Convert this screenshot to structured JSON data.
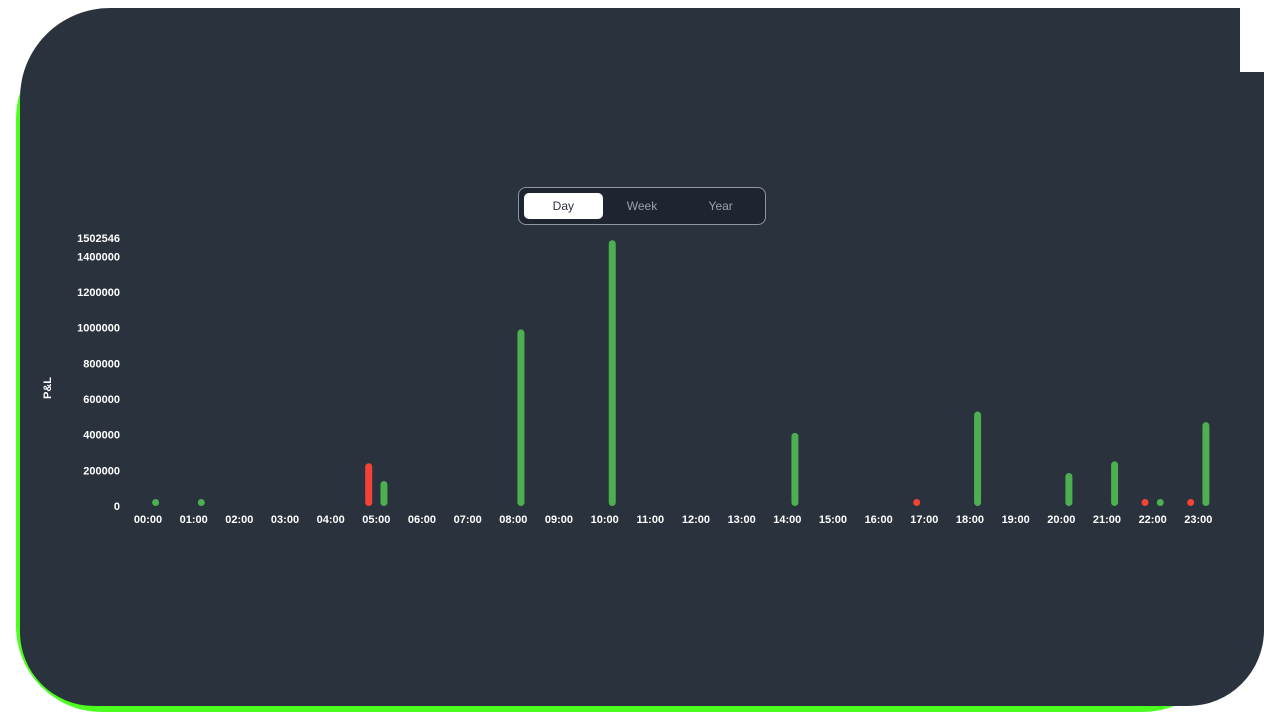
{
  "controls": {
    "tabs": [
      {
        "label": "Day",
        "active": true
      },
      {
        "label": "Week",
        "active": false
      },
      {
        "label": "Year",
        "active": false
      }
    ]
  },
  "colors": {
    "panel": "#29323d",
    "frame_accent": "#4cff1f",
    "positive": "#4caf50",
    "negative": "#f44336"
  },
  "chart_data": {
    "type": "bar",
    "ylabel": "P&L",
    "xlabel": "",
    "title": "",
    "ylim": [
      0,
      1502546
    ],
    "yticks": [
      0,
      200000,
      400000,
      600000,
      800000,
      1000000,
      1200000,
      1400000,
      1502546
    ],
    "xticks": [
      "00:00",
      "01:00",
      "02:00",
      "03:00",
      "04:00",
      "05:00",
      "06:00",
      "07:00",
      "08:00",
      "09:00",
      "10:00",
      "11:00",
      "12:00",
      "13:00",
      "14:00",
      "15:00",
      "16:00",
      "17:00",
      "18:00",
      "19:00",
      "20:00",
      "21:00",
      "22:00",
      "23:00"
    ],
    "grid": false,
    "points": [
      {
        "x": "00:10",
        "value": 20000,
        "sign": "positive"
      },
      {
        "x": "01:10",
        "value": 20000,
        "sign": "positive"
      },
      {
        "x": "04:50",
        "value": 240000,
        "sign": "negative"
      },
      {
        "x": "05:10",
        "value": 140000,
        "sign": "positive"
      },
      {
        "x": "08:10",
        "value": 990000,
        "sign": "positive"
      },
      {
        "x": "10:10",
        "value": 1490000,
        "sign": "positive"
      },
      {
        "x": "14:10",
        "value": 410000,
        "sign": "positive"
      },
      {
        "x": "16:50",
        "value": 20000,
        "sign": "negative"
      },
      {
        "x": "18:10",
        "value": 530000,
        "sign": "positive"
      },
      {
        "x": "20:10",
        "value": 185000,
        "sign": "positive"
      },
      {
        "x": "21:10",
        "value": 250000,
        "sign": "positive"
      },
      {
        "x": "21:50",
        "value": 15000,
        "sign": "negative"
      },
      {
        "x": "22:10",
        "value": 15000,
        "sign": "positive"
      },
      {
        "x": "22:50",
        "value": 15000,
        "sign": "negative"
      },
      {
        "x": "23:10",
        "value": 470000,
        "sign": "positive"
      }
    ]
  }
}
